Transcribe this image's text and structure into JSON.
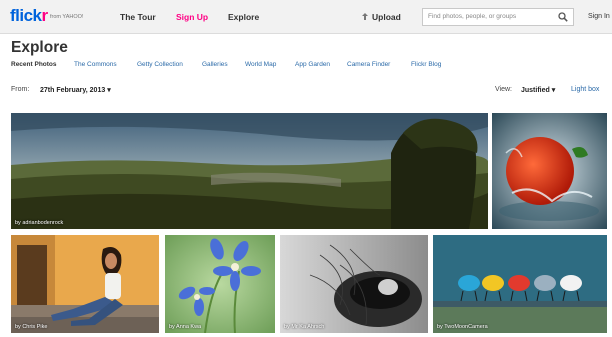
{
  "header": {
    "logo": {
      "part1": "flick",
      "part2": "r"
    },
    "by_text": "from YAHOO!",
    "nav": {
      "tour": "The Tour",
      "signup": "Sign Up",
      "explore": "Explore"
    },
    "upload": "Upload",
    "search": {
      "placeholder": "Find photos, people, or groups"
    },
    "signin": "Sign In"
  },
  "page": {
    "title": "Explore",
    "subnav": [
      "Recent Photos",
      "The Commons",
      "Getty Collection",
      "Galleries",
      "World Map",
      "App Garden",
      "Camera Finder",
      "Flickr Blog"
    ],
    "from_label": "From:",
    "from_date": "27th February, 2013",
    "view_label": "View:",
    "view_value": "Justified",
    "lightbox": "Light box"
  },
  "photos": [
    {
      "subject": "valley-landscape",
      "credit": "by adrianbodenrock"
    },
    {
      "subject": "tomato-splash",
      "credit": ""
    },
    {
      "subject": "woman-in-doorway",
      "credit": "by Chris Pike"
    },
    {
      "subject": "blue-flowers",
      "credit": "by Anna Kwa"
    },
    {
      "subject": "bird-nest",
      "credit": "by Mr Ka Ahrsch"
    },
    {
      "subject": "colored-chairs",
      "credit": "by TwoMoonCamera"
    }
  ],
  "colors": {
    "flickr_blue": "#0063dc",
    "flickr_pink": "#ff0084",
    "link_blue": "#2b6aa8"
  }
}
